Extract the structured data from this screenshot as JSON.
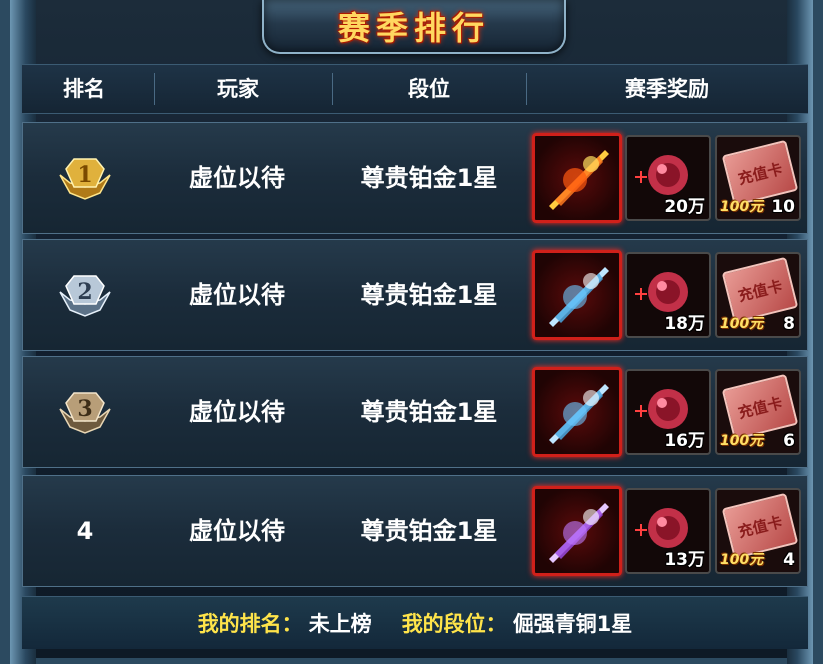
{
  "title": "赛季排行",
  "headers": [
    "排名",
    "玩家",
    "段位",
    "赛季奖励"
  ],
  "rows": [
    {
      "rank": "1",
      "player": "虚位以待",
      "tier": "尊贵铂金1星",
      "weapon": "flame-sword-icon",
      "gem_qty": "20万",
      "card_label": "充值卡",
      "card_value": "100元",
      "card_qty": "10"
    },
    {
      "rank": "2",
      "player": "虚位以待",
      "tier": "尊贵铂金1星",
      "weapon": "ice-sword-icon",
      "gem_qty": "18万",
      "card_label": "充值卡",
      "card_value": "100元",
      "card_qty": "8"
    },
    {
      "rank": "3",
      "player": "虚位以待",
      "tier": "尊贵铂金1星",
      "weapon": "ice-sword-icon",
      "gem_qty": "16万",
      "card_label": "充值卡",
      "card_value": "100元",
      "card_qty": "6"
    },
    {
      "rank": "4",
      "player": "虚位以待",
      "tier": "尊贵铂金1星",
      "weapon": "purple-sword-icon",
      "gem_qty": "13万",
      "card_label": "充值卡",
      "card_value": "100元",
      "card_qty": "4"
    }
  ],
  "footer": {
    "my_rank_label": "我的排名：",
    "my_rank_value": "未上榜",
    "my_tier_label": "我的段位：",
    "my_tier_value": "倔强青铜1星"
  },
  "colors": {
    "medal_gold": "#e0b13c",
    "medal_silver": "#b8c8d8",
    "medal_bronze": "#b89e78",
    "title": "#ffd860",
    "footer_label": "#ffe44a"
  }
}
